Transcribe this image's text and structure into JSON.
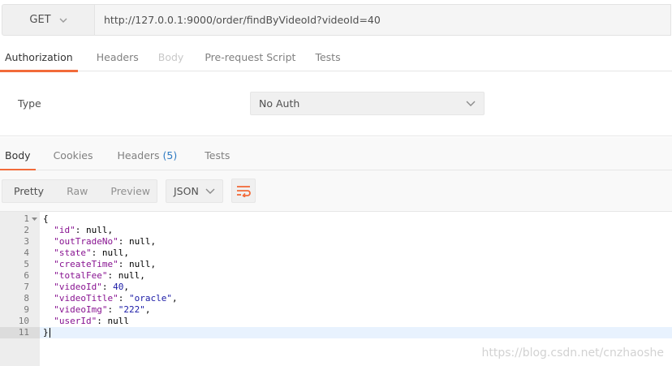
{
  "request": {
    "method": "GET",
    "url": "http://127.0.0.1:9000/order/findByVideoId?videoId=40"
  },
  "request_tabs": [
    {
      "label": "Authorization",
      "state": "active"
    },
    {
      "label": "Headers",
      "state": "normal"
    },
    {
      "label": "Body",
      "state": "disabled"
    },
    {
      "label": "Pre-request Script",
      "state": "normal"
    },
    {
      "label": "Tests",
      "state": "normal"
    }
  ],
  "auth": {
    "type_label": "Type",
    "type_value": "No Auth"
  },
  "response_tabs": {
    "body": "Body",
    "cookies": "Cookies",
    "headers": "Headers",
    "headers_count": "(5)",
    "tests": "Tests"
  },
  "view_modes": [
    "Pretty",
    "Raw",
    "Preview"
  ],
  "format": "JSON",
  "icons": {
    "method_dropdown": "chevron-down-icon",
    "auth_dropdown": "chevron-down-icon",
    "format_dropdown": "chevron-down-icon",
    "wrap": "wrap-lines-icon",
    "fold": "fold-arrow-icon"
  },
  "colors": {
    "accent": "#f26b3a",
    "key": "#881391",
    "string": "#1a1aa6",
    "count": "#2f7bc2"
  },
  "response_body": {
    "line_numbers": [
      "1",
      "2",
      "3",
      "4",
      "5",
      "6",
      "7",
      "8",
      "9",
      "10",
      "11"
    ],
    "open_brace": "{",
    "close_brace": "}",
    "fields": [
      {
        "key": "\"id\"",
        "value": "null",
        "comma": ","
      },
      {
        "key": "\"outTradeNo\"",
        "value": "null",
        "comma": ","
      },
      {
        "key": "\"state\"",
        "value": "null",
        "comma": ","
      },
      {
        "key": "\"createTime\"",
        "value": "null",
        "comma": ","
      },
      {
        "key": "\"totalFee\"",
        "value": "null",
        "comma": ","
      },
      {
        "key": "\"videoId\"",
        "value": "40",
        "comma": ","
      },
      {
        "key": "\"videoTitle\"",
        "value": "\"oracle\"",
        "comma": ","
      },
      {
        "key": "\"videoImg\"",
        "value": "\"222\"",
        "comma": ","
      },
      {
        "key": "\"userId\"",
        "value": "null",
        "comma": ""
      }
    ]
  },
  "watermark": "https://blog.csdn.net/cnzhaoshe"
}
